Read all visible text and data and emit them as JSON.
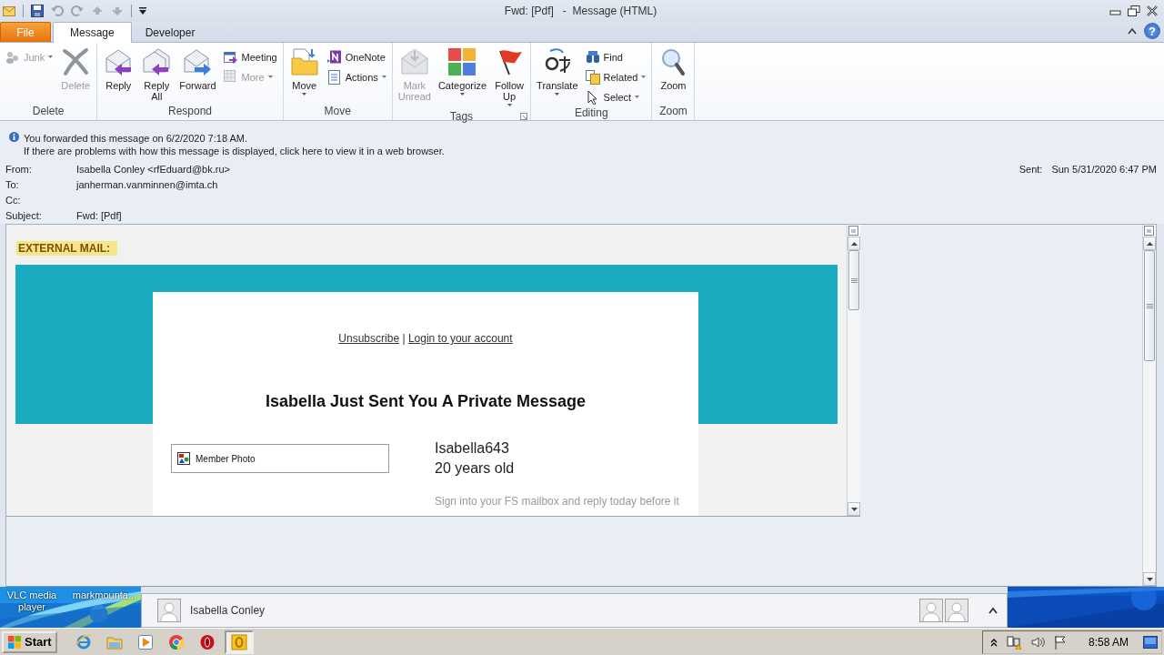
{
  "window": {
    "title": "Fwd: [Pdf]   -  Message (HTML)",
    "help": "?"
  },
  "tabs": [
    {
      "label": "File",
      "kind": "file",
      "selected": false
    },
    {
      "label": "Message",
      "kind": "tab",
      "selected": true
    },
    {
      "label": "Developer",
      "kind": "tab",
      "selected": false
    }
  ],
  "ribbon": {
    "groups": [
      {
        "label": "Delete",
        "items": [
          {
            "kind": "small",
            "label": "Junk",
            "disabled": true,
            "dropdown": true
          },
          {
            "kind": "large",
            "label": "Delete",
            "disabled": true,
            "dropdown": false
          }
        ]
      },
      {
        "label": "Respond",
        "items": [
          {
            "kind": "large",
            "label": "Reply",
            "disabled": false,
            "dropdown": false
          },
          {
            "kind": "large",
            "label": "Reply All",
            "disabled": false,
            "dropdown": false
          },
          {
            "kind": "large",
            "label": "Forward",
            "disabled": false,
            "dropdown": false
          },
          {
            "kind": "small",
            "label": "Meeting",
            "disabled": false,
            "dropdown": false
          },
          {
            "kind": "small",
            "label": "More",
            "disabled": true,
            "dropdown": true
          }
        ]
      },
      {
        "label": "Move",
        "items": [
          {
            "kind": "large",
            "label": "Move",
            "disabled": false,
            "dropdown": true
          },
          {
            "kind": "small",
            "label": "OneNote",
            "disabled": false,
            "dropdown": false
          },
          {
            "kind": "small",
            "label": "Actions",
            "disabled": false,
            "dropdown": true
          }
        ]
      },
      {
        "label": "Tags",
        "items": [
          {
            "kind": "large",
            "label": "Mark Unread",
            "disabled": true,
            "dropdown": false
          },
          {
            "kind": "large",
            "label": "Categorize",
            "disabled": false,
            "dropdown": true
          },
          {
            "kind": "large",
            "label": "Follow Up",
            "disabled": false,
            "dropdown": true
          }
        ]
      },
      {
        "label": "Editing",
        "items": [
          {
            "kind": "large",
            "label": "Translate",
            "disabled": false,
            "dropdown": true
          },
          {
            "kind": "small",
            "label": "Find",
            "disabled": false,
            "dropdown": false
          },
          {
            "kind": "small",
            "label": "Related",
            "disabled": false,
            "dropdown": true
          },
          {
            "kind": "small",
            "label": "Select",
            "disabled": false,
            "dropdown": true
          }
        ]
      },
      {
        "label": "Zoom",
        "items": [
          {
            "kind": "large",
            "label": "Zoom",
            "disabled": false,
            "dropdown": false
          }
        ]
      }
    ]
  },
  "info_bar": {
    "lines": [
      "You forwarded this message on 6/2/2020 7:18 AM.",
      "If there are problems with how this message is displayed, click here to view it in a web browser."
    ]
  },
  "header": {
    "fields": [
      {
        "label": "From:",
        "value": "Isabella Conley <rfEduard@bk.ru>"
      },
      {
        "label": "To:",
        "value": "janherman.vanminnen@imta.ch"
      },
      {
        "label": "Cc:"
      },
      {
        "label": "Subject:",
        "value": "Fwd: [Pdf]"
      }
    ],
    "sent": {
      "label": "Sent:",
      "value": "Sun 5/31/2020 6:47 PM"
    }
  },
  "message": {
    "external_mail": "EXTERNAL MAIL:",
    "links": [
      "Unsubscribe",
      "|",
      "Login to your account"
    ],
    "headline": "Isabella Just Sent You A Private Message",
    "photo_label": "Member Photo",
    "username": "Isabella643",
    "age": "20 years old",
    "note": "Sign into your FS mailbox and reply today before it"
  },
  "people_pane": {
    "name": "Isabella Conley"
  },
  "desktop_icons": [
    "VLC media player",
    "markmounta..."
  ],
  "taskbar": {
    "start": "Start",
    "clock": "8:58 AM",
    "apps": [
      {
        "selected": false
      },
      {
        "selected": false
      },
      {
        "selected": false
      },
      {
        "selected": false
      },
      {
        "selected": false
      },
      {
        "selected": true
      }
    ]
  }
}
